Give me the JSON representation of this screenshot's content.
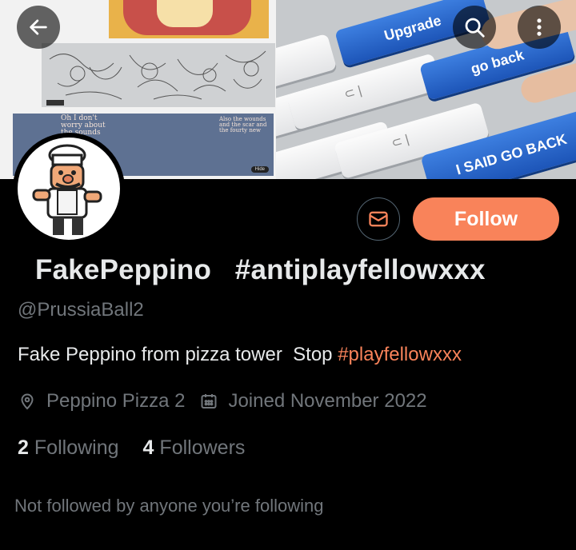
{
  "banner": {
    "collage_note_1": "Oh I don't worry about the sounds",
    "collage_note_2": "Also the wounds and the scar and the fourty new",
    "collage_hide_label": "Hide",
    "key_upgrade": "Upgrade",
    "key_go_back": "go back",
    "key_said_go_back": "I SAID GO BACK"
  },
  "header": {
    "back_icon": "arrow-left-icon",
    "search_icon": "search-icon",
    "more_icon": "more-vertical-icon"
  },
  "profile": {
    "display_name": "FakePeppino   #antiplayfellowxxx",
    "handle": "@PrussiaBall2",
    "bio_text": "Fake Peppino from pizza tower  Stop ",
    "bio_hashtag": "#playfellowxxx",
    "location": "Peppino Pizza 2",
    "joined": "Joined November 2022",
    "following_count": "2",
    "following_label": "Following",
    "followers_count": "4",
    "followers_label": "Followers",
    "mutuals_text": "Not followed by anyone you’re following"
  },
  "actions": {
    "follow_label": "Follow",
    "message_icon": "envelope-icon"
  },
  "colors": {
    "accent": "#f9835a",
    "background": "#000000",
    "secondary_text": "#71767b",
    "primary_text": "#e7e9ea"
  }
}
